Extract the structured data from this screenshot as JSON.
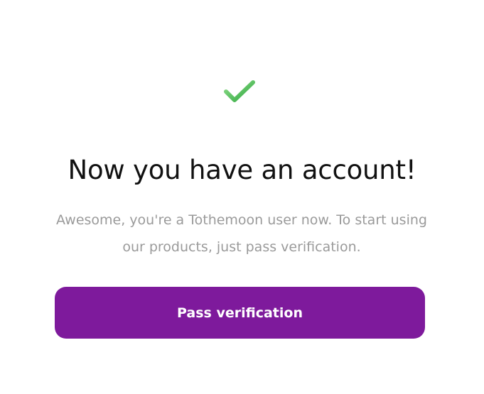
{
  "success": {
    "icon": "checkmark-icon",
    "icon_color": "#4cbb5a",
    "title": "Now you have an account!",
    "message": "Awesome, you're a Tothemoon user now. To start using our products, just pass verification."
  },
  "actions": {
    "pass_verification_label": "Pass verification",
    "button_color": "#7e1a9c"
  }
}
